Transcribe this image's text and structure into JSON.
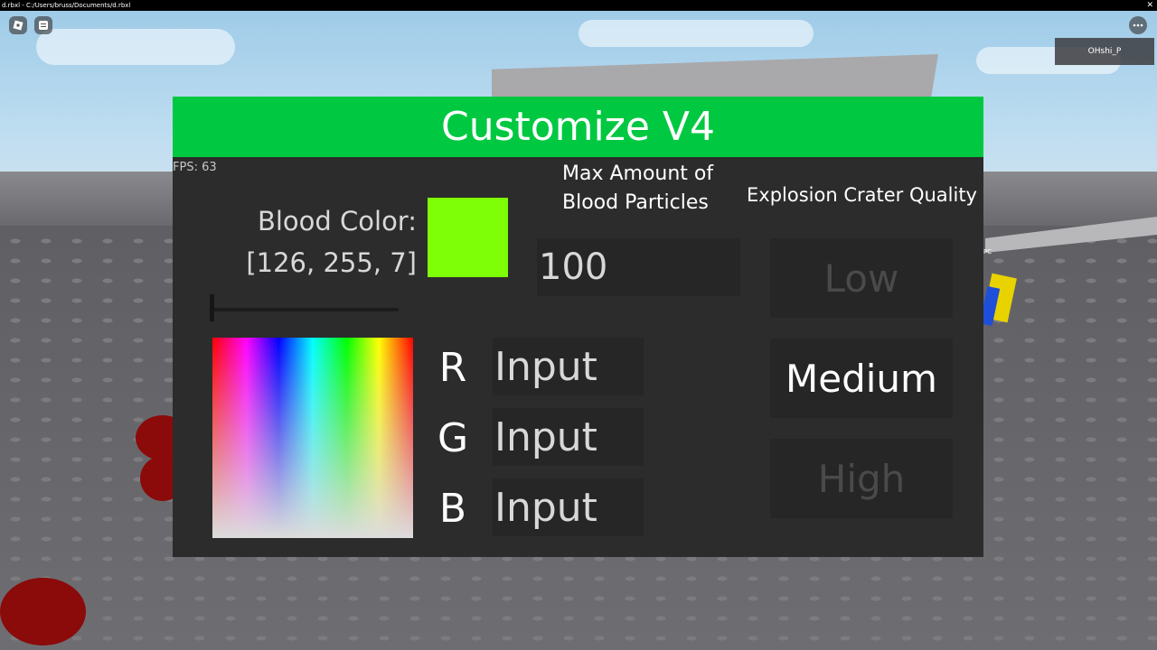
{
  "window": {
    "title": "d.rbxl - C:/Users/bruss/Documents/d.rbxl",
    "close_glyph": "✕"
  },
  "topbar": {
    "roblox_icon": "roblox-icon",
    "chat_icon": "chat-icon",
    "menu_icon": "menu-dots-icon",
    "player_name": "OHshi_P"
  },
  "scene": {
    "npc_label": "PC"
  },
  "panel": {
    "title": "Customize V4",
    "header_color": "#00c841",
    "background_color": "#2c2c2c",
    "fps": "FPS: 63",
    "blood_color_label": "Blood Color: [126, 255, 7]",
    "blood_color_rgb": [
      126,
      255,
      7
    ],
    "blood_color_hex": "#7eff07",
    "rgb": {
      "r_label": "R",
      "g_label": "G",
      "b_label": "B",
      "r_placeholder": "Input",
      "g_placeholder": "Input",
      "b_placeholder": "Input"
    },
    "max_particles": {
      "label": "Max Amount of Blood Particles",
      "value": "100"
    },
    "crater_quality": {
      "label": "Explosion Crater Quality",
      "low": "Low",
      "medium": "Medium",
      "high": "High",
      "selected": "Medium"
    }
  }
}
